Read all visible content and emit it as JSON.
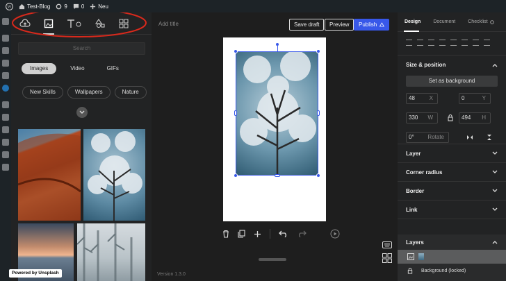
{
  "adminbar": {
    "site_name": "Test-Blog",
    "updates_count": "9",
    "comments_count": "0",
    "new_label": "Neu"
  },
  "library": {
    "search_placeholder": "Search",
    "media_tabs": [
      "Images",
      "Video",
      "GIFs"
    ],
    "active_media_tab": "Images",
    "categories": [
      "New Skills",
      "Wallpapers",
      "Nature"
    ],
    "credit": "Powered by Unsplash"
  },
  "editor": {
    "title_placeholder": "Add title",
    "save_draft_label": "Save draft",
    "preview_label": "Preview",
    "publish_label": "Publish",
    "version": "Version 1.3.0"
  },
  "inspector": {
    "tabs": [
      "Design",
      "Document",
      "Checklist"
    ],
    "active_tab": "Design",
    "size_position": {
      "title": "Size & position",
      "set_background_label": "Set as background",
      "x_value": "48",
      "x_unit": "X",
      "y_value": "0",
      "y_unit": "Y",
      "w_value": "330",
      "w_unit": "W",
      "h_value": "494",
      "h_unit": "H",
      "rotate_value": "0°",
      "rotate_label": "Rotate"
    },
    "sections": [
      "Layer",
      "Corner radius",
      "Border",
      "Link"
    ],
    "layers_title": "Layers",
    "background_layer": "Background (locked)"
  },
  "colors": {
    "accent": "#3858e9",
    "annotation": "#d9291c"
  }
}
